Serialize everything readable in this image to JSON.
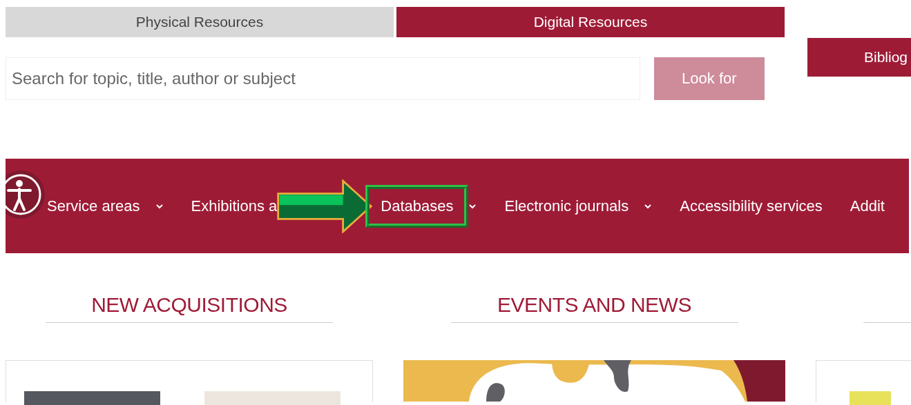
{
  "resource_tabs": [
    {
      "label": "Physical Resources",
      "selected": false
    },
    {
      "label": "Digital Resources",
      "selected": true
    }
  ],
  "search": {
    "placeholder": "Search for topic, title, author or subject",
    "button": "Look for"
  },
  "side_button": "Bibliog",
  "nav": {
    "items": [
      {
        "label": "Service areas",
        "has_dropdown": true,
        "highlighted": false
      },
      {
        "label": "Exhibitions a",
        "has_dropdown": false,
        "highlighted": false
      },
      {
        "label": "Databases",
        "has_dropdown": true,
        "highlighted": true
      },
      {
        "label": "Electronic journals",
        "has_dropdown": true,
        "highlighted": false
      },
      {
        "label": "Accessibility services",
        "has_dropdown": false,
        "highlighted": false
      },
      {
        "label": "Addit",
        "has_dropdown": false,
        "highlighted": false
      }
    ]
  },
  "sections": [
    {
      "title": "NEW ACQUISITIONS",
      "kind": "books"
    },
    {
      "title": "EVENTS AND NEWS",
      "kind": "event"
    },
    {
      "kind": "partial"
    }
  ]
}
